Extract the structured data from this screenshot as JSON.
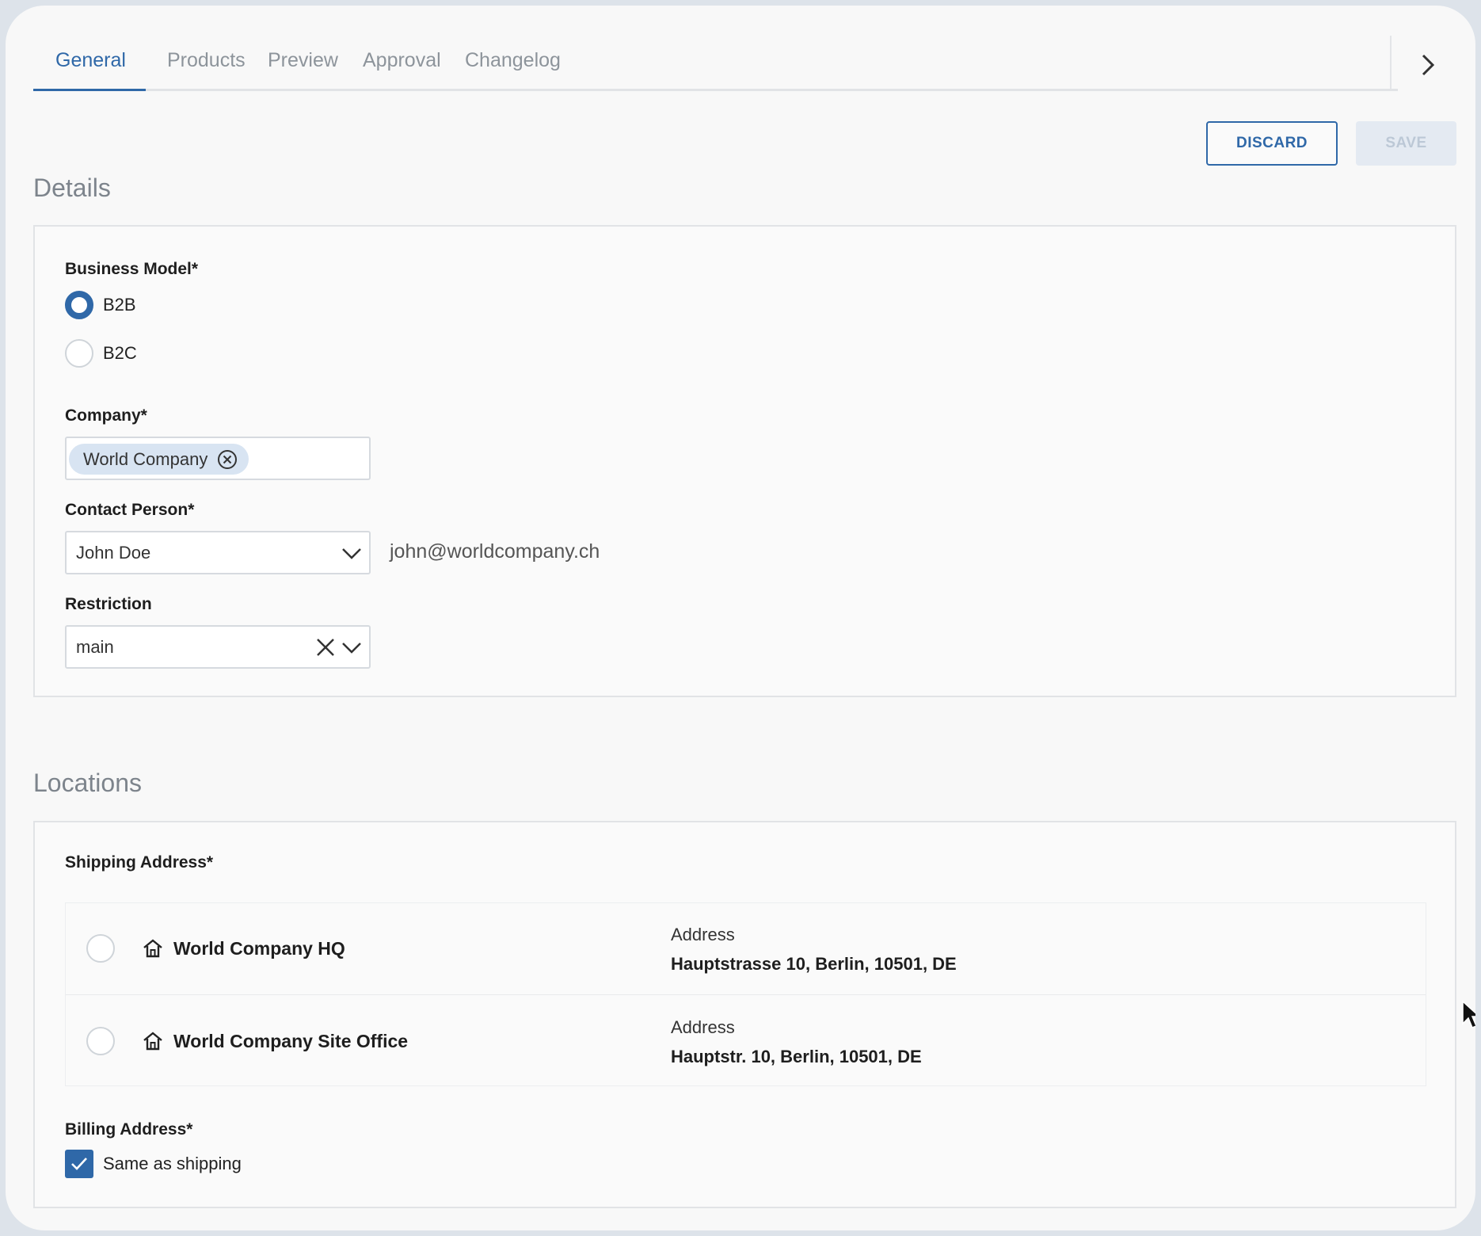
{
  "tabs": [
    {
      "label": "General",
      "active": true
    },
    {
      "label": "Products"
    },
    {
      "label": "Preview"
    },
    {
      "label": "Approval"
    },
    {
      "label": "Changelog"
    }
  ],
  "actions": {
    "discard_label": "DISCARD",
    "save_label": "SAVE",
    "save_disabled": true
  },
  "details": {
    "title": "Details",
    "business_model": {
      "label": "Business Model*",
      "options": [
        {
          "label": "B2B",
          "selected": true
        },
        {
          "label": "B2C",
          "selected": false
        }
      ]
    },
    "company": {
      "label": "Company*",
      "chip": "World Company"
    },
    "contact": {
      "label": "Contact Person*",
      "value": "John Doe",
      "email": "john@worldcompany.ch"
    },
    "restriction": {
      "label": "Restriction",
      "value": "main"
    }
  },
  "locations": {
    "title": "Locations",
    "shipping": {
      "label": "Shipping Address*",
      "addresses": [
        {
          "name": "World Company HQ",
          "address_label": "Address",
          "address": "Hauptstrasse 10, Berlin, 10501, DE",
          "icon": "home-icon",
          "selected": false
        },
        {
          "name": "World Company Site Office",
          "address_label": "Address",
          "address": "Hauptstr. 10, Berlin, 10501, DE",
          "icon": "home-icon",
          "selected": false
        }
      ]
    },
    "billing": {
      "label": "Billing Address*",
      "same_as_shipping_label": "Same as shipping",
      "same_as_shipping": true
    }
  },
  "colors": {
    "accent": "#2f68a8",
    "chip_bg": "#d8e4f2",
    "save_disabled_bg": "#e4eaf2"
  }
}
